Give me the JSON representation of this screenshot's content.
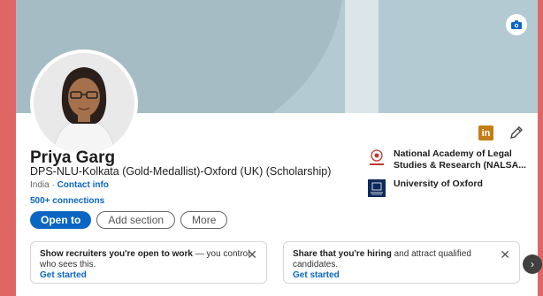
{
  "profile": {
    "name": "Priya Garg",
    "headline": "DPS-NLU-Kolkata (Gold-Medallist)-Oxford (UK) (Scholarship)",
    "location": "India",
    "location_sep": " · ",
    "contact_info": "Contact info",
    "connections": "500+ connections"
  },
  "actions": {
    "open_to": "Open to",
    "add_section": "Add section",
    "more": "More"
  },
  "education": [
    {
      "name": "National Academy of Legal Studies & Research (NALSA...",
      "logo": "nalsar-logo"
    },
    {
      "name": "University of Oxford",
      "logo": "oxford-logo"
    }
  ],
  "promos": [
    {
      "bold": "Show recruiters you're open to work",
      "rest": " — you control who sees this.",
      "link": "Get started"
    },
    {
      "bold": "Share that you're hiring",
      "rest": " and attract qualified candidates.",
      "link": "Get started"
    }
  ],
  "icons": {
    "camera": "camera-icon",
    "linkedin": "linkedin-icon",
    "edit": "pencil-icon",
    "close": "close-icon",
    "next": "chevron-right-icon"
  },
  "colors": {
    "accent": "#0a66c2",
    "banner": "#b3cad3",
    "linkedin_badge": "#c37d16",
    "page_bg": "#e06666"
  }
}
